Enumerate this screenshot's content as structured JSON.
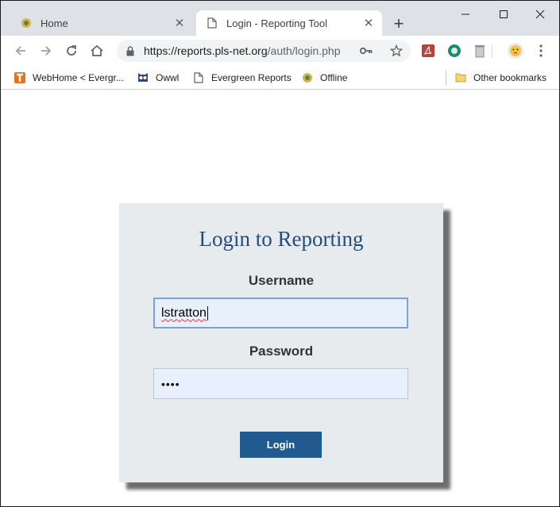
{
  "browser": {
    "tabs": [
      {
        "title": "Home",
        "close": "✕",
        "icon": "evergreen-favicon"
      },
      {
        "title": "Login - Reporting Tool",
        "close": "✕",
        "icon": "page-icon"
      }
    ],
    "new_tab": "+",
    "window_controls": {
      "minimize": "minimize",
      "maximize": "maximize",
      "close": "close"
    },
    "url_host": "https://reports.pls-net.org",
    "url_path": "/auth/login.php",
    "bookmarks": [
      {
        "label": "WebHome < Evergr...",
        "icon": "twiki-icon"
      },
      {
        "label": "Owwl",
        "icon": "owl-icon"
      },
      {
        "label": "Evergreen Reports",
        "icon": "page-icon"
      },
      {
        "label": "Offline",
        "icon": "evergreen-favicon"
      }
    ],
    "other_bookmarks": "Other bookmarks"
  },
  "login": {
    "title": "Login to Reporting",
    "username_label": "Username",
    "username_value": "lstratton",
    "password_label": "Password",
    "password_value": "••••",
    "submit_label": "Login"
  },
  "colors": {
    "card_bg": "#e8ebee",
    "title_color": "#234d7d",
    "button_bg": "#215a8f",
    "input_bg": "#e8f0fe",
    "focus_border": "#7ba3da"
  }
}
